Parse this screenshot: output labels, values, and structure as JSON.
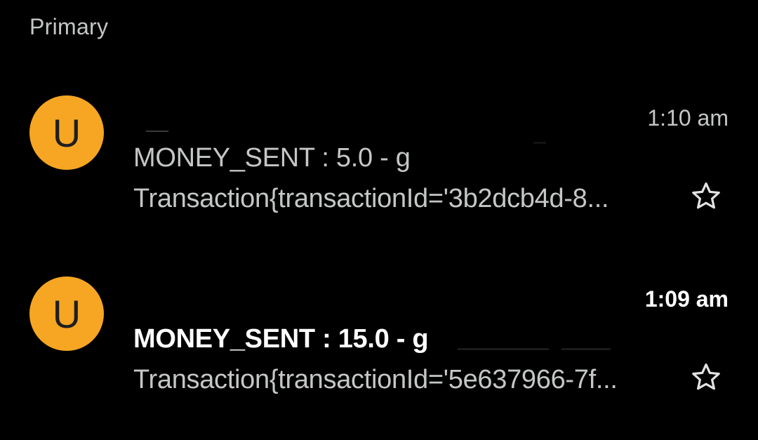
{
  "section": {
    "label": "Primary"
  },
  "emails": [
    {
      "avatar_letter": "U",
      "time": "1:10 am",
      "subject": "MONEY_SENT : 5.0 - g",
      "snippet": "Transaction{transactionId='3b2dcb4d-8...",
      "unread": false,
      "starred": false
    },
    {
      "avatar_letter": "U",
      "time": "1:09 am",
      "subject": "MONEY_SENT : 15.0 - g",
      "snippet": "Transaction{transactionId='5e637966-7f...",
      "unread": true,
      "starred": false
    }
  ],
  "colors": {
    "background": "#000000",
    "avatar": "#f6a623",
    "text_primary": "#ffffff",
    "text_secondary": "#c4c7c5"
  },
  "icons": {
    "star": "star-outline-icon"
  }
}
